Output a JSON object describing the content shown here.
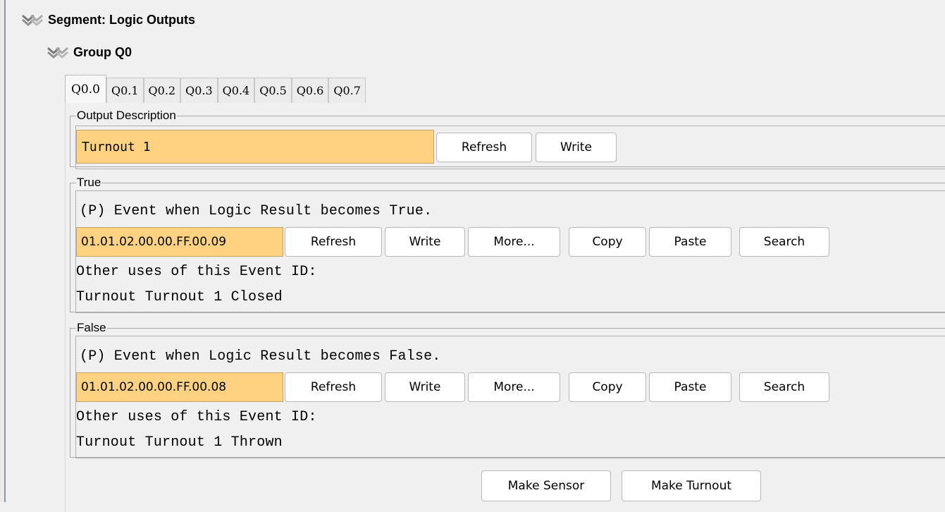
{
  "segment": {
    "label": "Segment: Logic Outputs"
  },
  "group": {
    "label": "Group Q0"
  },
  "tabs": [
    "Q0.0",
    "Q0.1",
    "Q0.2",
    "Q0.3",
    "Q0.4",
    "Q0.5",
    "Q0.6",
    "Q0.7"
  ],
  "active_tab": "Q0.0",
  "output_description": {
    "legend": "Output Description",
    "value": "Turnout 1",
    "refresh_label": "Refresh",
    "write_label": "Write"
  },
  "true_section": {
    "legend": "True",
    "description": "(P) Event when Logic Result becomes True.",
    "event_id": "01.01.02.00.00.FF.00.09",
    "buttons": {
      "refresh": "Refresh",
      "write": "Write",
      "more": "More...",
      "copy": "Copy",
      "paste": "Paste",
      "search": "Search"
    },
    "other_uses_label": "Other uses of this Event ID:",
    "other_uses_value": "Turnout Turnout 1 Closed"
  },
  "false_section": {
    "legend": "False",
    "description": "(P) Event when Logic Result becomes False.",
    "event_id": "01.01.02.00.00.FF.00.08",
    "buttons": {
      "refresh": "Refresh",
      "write": "Write",
      "more": "More...",
      "copy": "Copy",
      "paste": "Paste",
      "search": "Search"
    },
    "other_uses_label": "Other uses of this Event ID:",
    "other_uses_value": "Turnout Turnout 1 Thrown"
  },
  "footer": {
    "make_sensor": "Make Sensor",
    "make_turnout": "Make Turnout"
  },
  "colors": {
    "field_bg": "#ffd281",
    "background": "#f0f0f0",
    "button_bg": "#ffffff"
  },
  "icons": {
    "expand": "double-chevron-down-icon"
  }
}
